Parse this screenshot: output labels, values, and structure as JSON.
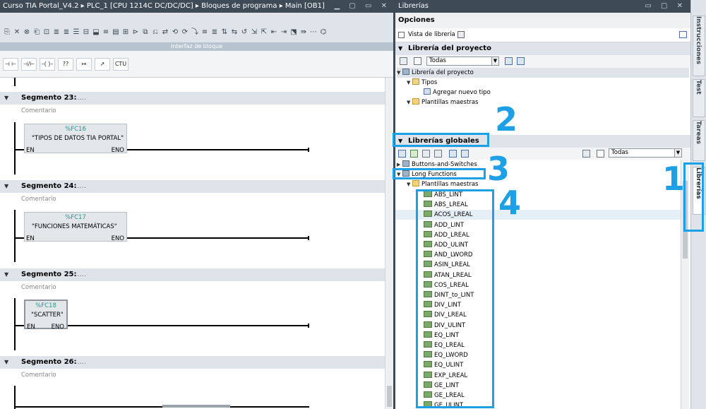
{
  "editor": {
    "title": "Curso TIA Portal_V4.2  ▸  PLC_1 [CPU 1214C DC/DC/DC]  ▸  Bloques de programa  ▸  Main [OB1]",
    "interface_bar": "Interfaz de bloque",
    "favorites": [
      "⊣ ⊢",
      "⊣/⊢",
      "–( )–",
      "??",
      "↦",
      "↗",
      "CTU"
    ],
    "segments": [
      {
        "label": "Segmento 23:",
        "dots": ".....",
        "comment": "Comentario",
        "block_number": "%FC16",
        "block_name": "\"TIPOS DE DATOS TIA PORTAL\"",
        "en": "EN",
        "eno": "ENO"
      },
      {
        "label": "Segmento 24:",
        "dots": ".....",
        "comment": "Comentario",
        "block_number": "%FC17",
        "block_name": "\"FUNCIONES MATEMÁTICAS\"",
        "en": "EN",
        "eno": "ENO"
      },
      {
        "label": "Segmento 25:",
        "dots": ".....",
        "comment": "Comentario",
        "block_number": "%FC18",
        "block_name": "\"SCATTER\"",
        "en": "EN",
        "eno": "ENO"
      },
      {
        "label": "Segmento 26:",
        "dots": ".....",
        "comment": "Comentario"
      }
    ]
  },
  "library": {
    "title": "Librerías",
    "options": "Opciones",
    "library_view": "Vista de librería",
    "project_library_header": "Librería del proyecto",
    "filter_value": "Todas",
    "project_tree": {
      "root": "Librería del proyecto",
      "types": "Tipos",
      "add_type": "Agregar nuevo tipo",
      "master_copies": "Plantillas maestras"
    },
    "global_libraries_header": "Librerías globales",
    "global_filter_value": "Todas",
    "global_tree": {
      "lib1": "Buttons-and-Switches",
      "lib2": "Long Functions",
      "master_copies": "Plantillas maestras",
      "items": [
        "ABS_LINT",
        "ABS_LREAL",
        "ACOS_LREAL",
        "ADD_LINT",
        "ADD_LREAL",
        "ADD_ULINT",
        "AND_LWORD",
        "ASIN_LREAL",
        "ATAN_LREAL",
        "COS_LREAL",
        "DINT_to_LINT",
        "DIV_LINT",
        "DIV_LREAL",
        "DIV_ULINT",
        "EQ_LINT",
        "EQ_LREAL",
        "EQ_LWORD",
        "EQ_ULINT",
        "EXP_LREAL",
        "GE_LINT",
        "GE_LREAL",
        "GE_ULINT"
      ]
    }
  },
  "side_tabs": [
    "Instrucciones",
    "Test",
    "Tareas",
    "Librerías"
  ],
  "annotations": [
    "1",
    "2",
    "3",
    "4"
  ],
  "colors": {
    "annotation": "#1ea0e6",
    "title_bar": "#3e4a56",
    "fc_number": "#1a9a92"
  }
}
